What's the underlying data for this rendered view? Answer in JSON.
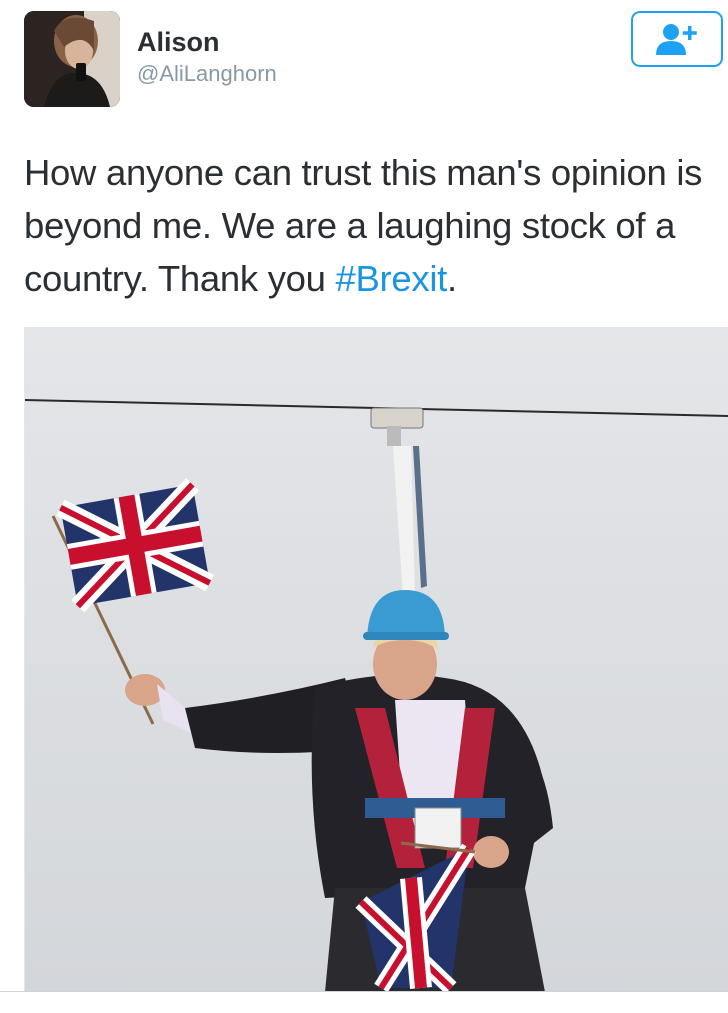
{
  "user": {
    "display_name": "Alison",
    "handle": "@AliLanghorn",
    "avatar_icon": "profile-photo"
  },
  "follow_button": {
    "icon": "follow-user-plus-icon",
    "color": "#1da1f2"
  },
  "tweet": {
    "text_part1": "How anyone can trust this man's opinion is beyond me. We are a laughing stock of a country. Thank you ",
    "hashtag": "#Brexit",
    "text_end": ".",
    "hashtag_color": "#1b95e0"
  }
}
